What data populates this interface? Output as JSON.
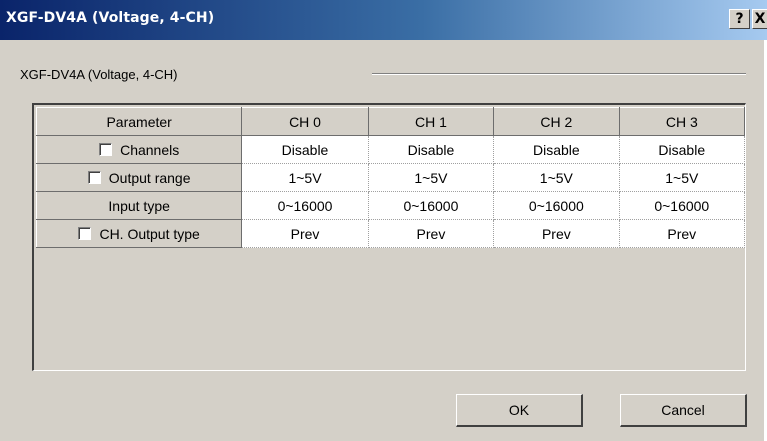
{
  "window": {
    "title": "XGF-DV4A (Voltage, 4-CH)",
    "help_label": "?",
    "close_label": "X"
  },
  "caption": "XGF-DV4A (Voltage, 4-CH)",
  "table": {
    "columns": [
      "Parameter",
      "CH 0",
      "CH 1",
      "CH 2",
      "CH 3"
    ],
    "rows": [
      {
        "label": "Channels",
        "checkbox": true,
        "values": [
          "Disable",
          "Disable",
          "Disable",
          "Disable"
        ]
      },
      {
        "label": "Output range",
        "checkbox": true,
        "values": [
          "1~5V",
          "1~5V",
          "1~5V",
          "1~5V"
        ]
      },
      {
        "label": "Input type",
        "checkbox": false,
        "values": [
          "0~16000",
          "0~16000",
          "0~16000",
          "0~16000"
        ]
      },
      {
        "label": "CH. Output type",
        "checkbox": true,
        "values": [
          "Prev",
          "Prev",
          "Prev",
          "Prev"
        ]
      }
    ]
  },
  "buttons": {
    "ok": "OK",
    "cancel": "Cancel"
  }
}
